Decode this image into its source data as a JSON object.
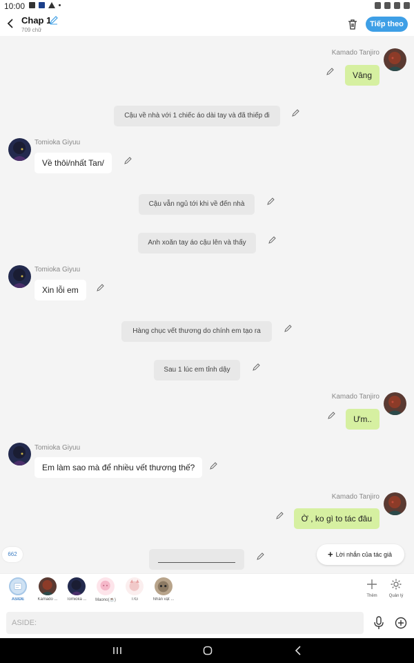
{
  "status_bar": {
    "time": "10:00"
  },
  "header": {
    "title": "Chap 1",
    "word_count": "709 chữ",
    "next_label": "Tiếp theo"
  },
  "messages": [
    {
      "type": "right",
      "name": "Kamado Tanjiro",
      "text": "Vâng"
    },
    {
      "type": "narration",
      "text": "Cậu về nhà với 1 chiếc áo dài tay và đã thiếp đi"
    },
    {
      "type": "left",
      "name": "Tomioka Giyuu",
      "text": "Về thôi/nhất Tan/"
    },
    {
      "type": "narration",
      "text": "Cậu vẫn ngủ tới khi về đến nhà"
    },
    {
      "type": "narration",
      "text": "Anh xoăn tay áo cậu lên và thấy"
    },
    {
      "type": "left",
      "name": "Tomioka Giyuu",
      "text": "Xin lỗi em"
    },
    {
      "type": "narration",
      "text": "Hàng chục vết thương do chính em tạo ra"
    },
    {
      "type": "narration",
      "text": "Sau 1 lúc em tỉnh dậy"
    },
    {
      "type": "right",
      "name": "Kamado Tanjiro",
      "text": "Ưm.."
    },
    {
      "type": "left",
      "name": "Tomioka Giyuu",
      "text": "Em làm sao mà để nhiều vết thương thế?"
    },
    {
      "type": "right",
      "name": "Kamado Tanjiro",
      "text": "Ờ , ko gì to tác đâu"
    }
  ],
  "counter": "662",
  "author_note_label": "Lời nhắn của tác giả",
  "characters": [
    {
      "label": "ASIDE"
    },
    {
      "label": "Kamado ..."
    },
    {
      "label": "Tomioka ..."
    },
    {
      "label": "Maono(☕)"
    },
    {
      "label": "T/G"
    },
    {
      "label": "Nhân vật ..."
    }
  ],
  "tools": {
    "add_label": "Thêm",
    "manage_label": "Quản lý"
  },
  "input": {
    "placeholder": "ASIDE:"
  },
  "colors": {
    "accent": "#3e9fe6",
    "right_bubble": "#d6f0a1",
    "narration": "#e8e8e8",
    "background": "#f4f4f4"
  },
  "icons": [
    "back-icon",
    "pencil-icon",
    "trash-icon",
    "microphone-icon",
    "plus-circle-icon",
    "gear-icon",
    "plus-icon"
  ]
}
